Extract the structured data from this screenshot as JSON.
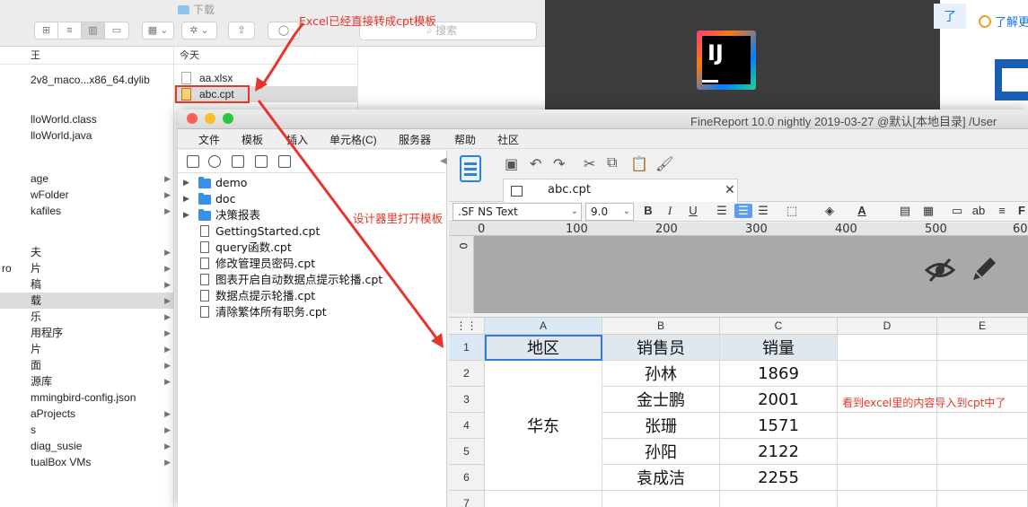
{
  "finder": {
    "folder_title": "下载",
    "search_placeholder": "搜索",
    "col1_header": "王",
    "col2_header": "今天",
    "col1_items": [
      {
        "label": "2v8_maco...x86_64.dylib",
        "arrow": ""
      },
      {
        "label": "lloWorld.class",
        "arrow": ""
      },
      {
        "label": "lloWorld.java",
        "arrow": ""
      },
      {
        "label": "age",
        "arrow": "▶"
      },
      {
        "label": "wFolder",
        "arrow": "▶"
      },
      {
        "label": "kafiles",
        "arrow": "▶"
      },
      {
        "label": "夫",
        "arrow": "▶"
      },
      {
        "label": "片",
        "arrow": "▶"
      },
      {
        "label": "稿",
        "arrow": "▶"
      },
      {
        "label": "载",
        "arrow": "▶"
      },
      {
        "label": "乐",
        "arrow": "▶"
      },
      {
        "label": "用程序",
        "arrow": "▶"
      },
      {
        "label": "片",
        "arrow": "▶"
      },
      {
        "label": "面",
        "arrow": "▶"
      },
      {
        "label": "源库",
        "arrow": "▶"
      },
      {
        "label": "mmingbird-config.json",
        "arrow": ""
      },
      {
        "label": "aProjects",
        "arrow": "▶"
      },
      {
        "label": "s",
        "arrow": "▶"
      },
      {
        "label": "diag_susie",
        "arrow": "▶"
      },
      {
        "label": "tualBox VMs",
        "arrow": "▶"
      }
    ],
    "sidebar_fragment": "ro",
    "col2_items": [
      "aa.xlsx",
      "abc.cpt"
    ]
  },
  "browser": {
    "tab_text": "了",
    "link_text": "了解更"
  },
  "ij": {
    "logo_text": "IJ"
  },
  "finereport": {
    "title": "FineReport 10.0 nightly 2019-03-27 @默认[本地目录]   /User",
    "menu": [
      "文件",
      "模板",
      "插入",
      "单元格(C)",
      "服务器",
      "帮助",
      "社区"
    ],
    "tree": [
      {
        "label": "demo",
        "type": "folder"
      },
      {
        "label": "doc",
        "type": "folder"
      },
      {
        "label": "决策报表",
        "type": "folder"
      },
      {
        "label": "GettingStarted.cpt",
        "type": "file"
      },
      {
        "label": "query函数.cpt",
        "type": "file"
      },
      {
        "label": "修改管理员密码.cpt",
        "type": "file"
      },
      {
        "label": "图表开启自动数据点提示轮播.cpt",
        "type": "file"
      },
      {
        "label": "数据点提示轮播.cpt",
        "type": "file"
      },
      {
        "label": "清除繁体所有职务.cpt",
        "type": "file"
      }
    ],
    "tab_label": "abc.cpt",
    "font_name": ".SF NS Text",
    "font_size": "9.0",
    "ruler": [
      "0",
      "100",
      "200",
      "300",
      "400",
      "500",
      "60"
    ],
    "vruler": "0",
    "columns": [
      "A",
      "B",
      "C",
      "D",
      "E"
    ],
    "rows": [
      "1",
      "2",
      "3",
      "4",
      "5",
      "6",
      "7"
    ],
    "headers": [
      "地区",
      "销售员",
      "销量"
    ],
    "region": "华东",
    "sales": [
      {
        "name": "孙林",
        "amount": "1869"
      },
      {
        "name": "金士鹏",
        "amount": "2001"
      },
      {
        "name": "张珊",
        "amount": "1571"
      },
      {
        "name": "孙阳",
        "amount": "2122"
      },
      {
        "name": "袁成洁",
        "amount": "2255"
      }
    ]
  },
  "annotations": {
    "top": "Excel已经直接转成cpt模板",
    "middle": "设计器里打开模板",
    "right": "看到excel里的内容导入到cpt中了",
    "color": "#e8352a"
  }
}
